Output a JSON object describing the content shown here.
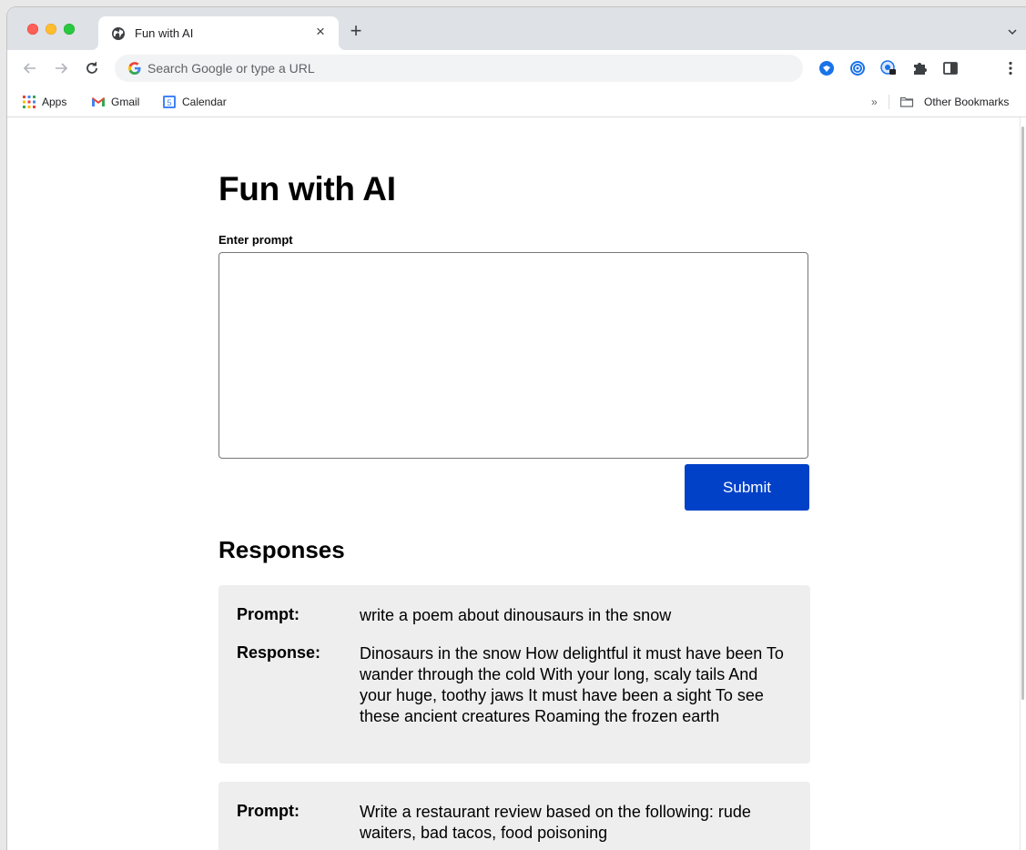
{
  "browser": {
    "tab": {
      "title": "Fun with AI"
    },
    "omnibox": {
      "placeholder": "Search Google or type a URL"
    },
    "bookmarks": [
      {
        "label": "Apps",
        "icon": "apps-grid-icon"
      },
      {
        "label": "Gmail",
        "icon": "gmail-icon"
      },
      {
        "label": "Calendar",
        "icon": "calendar-icon",
        "badge": "5"
      }
    ],
    "overflow_label": "»",
    "other_bookmarks": "Other Bookmarks"
  },
  "page": {
    "title": "Fun with AI",
    "prompt_label": "Enter prompt",
    "prompt_value": "",
    "submit_label": "Submit",
    "responses_heading": "Responses",
    "prompt_key": "Prompt:",
    "response_key": "Response:",
    "responses": [
      {
        "prompt": "write a poem about dinousaurs in the snow",
        "response": "Dinosaurs in the snow How delightful it must have been To wander through the cold With your long, scaly tails And your huge, toothy jaws It must have been a sight To see these ancient creatures Roaming the frozen earth"
      },
      {
        "prompt": "Write a restaurant review based on the following: rude waiters, bad tacos, food poisoning"
      }
    ]
  },
  "colors": {
    "submit_bg": "#0041c8",
    "card_bg": "#eeeeee",
    "tab_strip_bg": "#dee1e6"
  }
}
